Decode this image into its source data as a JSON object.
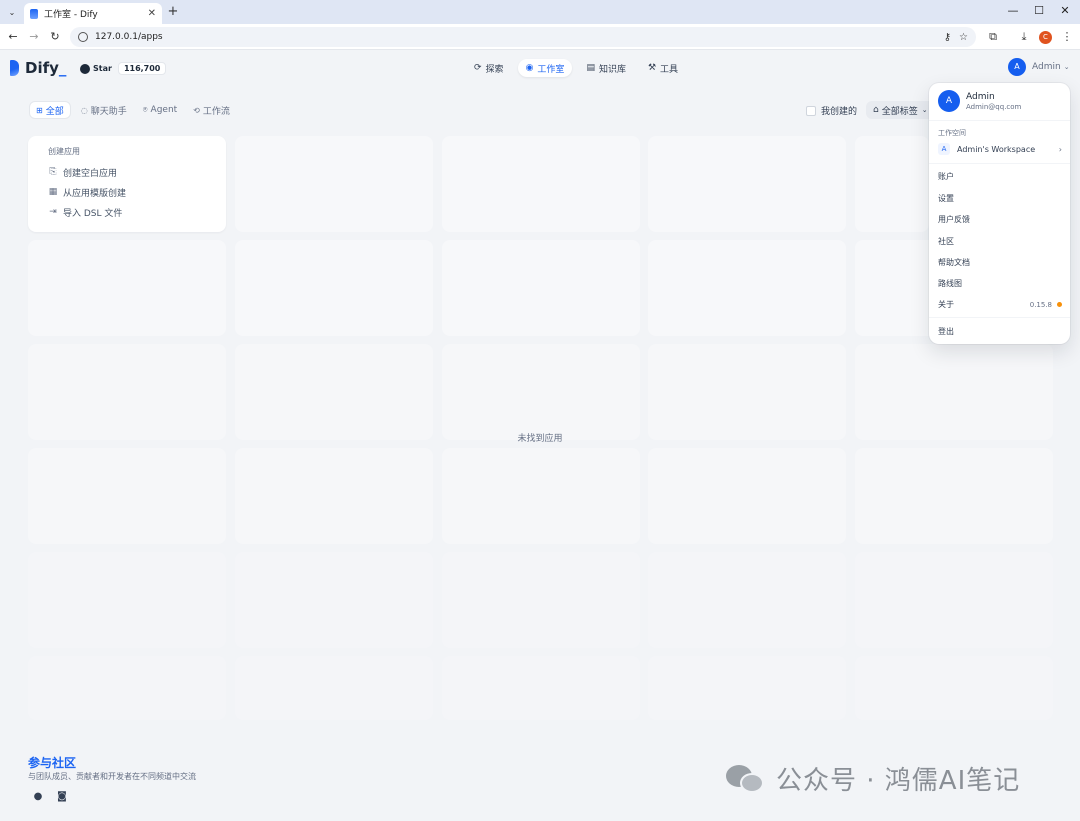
{
  "browser": {
    "tab_title": "工作室 - Dify",
    "url": "127.0.0.1/apps",
    "profile_initial": "C"
  },
  "header": {
    "logo_text": "Dify",
    "github": {
      "label": "Star",
      "count": "116,700"
    },
    "nav": [
      {
        "label": "探索",
        "icon": "explore-icon"
      },
      {
        "label": "工作室",
        "icon": "robot-icon"
      },
      {
        "label": "知识库",
        "icon": "book-icon"
      },
      {
        "label": "工具",
        "icon": "tool-icon"
      }
    ],
    "user": {
      "initial": "A",
      "name": "Admin"
    }
  },
  "filters": {
    "tabs": [
      {
        "label": "全部",
        "icon": "grid-icon"
      },
      {
        "label": "聊天助手",
        "icon": "chat-icon"
      },
      {
        "label": "Agent",
        "icon": "agent-icon"
      },
      {
        "label": "工作流",
        "icon": "workflow-icon"
      }
    ],
    "mine_label": "我创建的",
    "tag_filter": "全部标签"
  },
  "create_card": {
    "title": "创建应用",
    "items": [
      {
        "label": "创建空白应用",
        "icon": "file-plus-icon"
      },
      {
        "label": "从应用模版创建",
        "icon": "template-icon"
      },
      {
        "label": "导入 DSL 文件",
        "icon": "import-icon"
      }
    ]
  },
  "empty_text": "未找到应用",
  "footer": {
    "title": "参与社区",
    "subtitle": "与团队成员、贡献者和开发者在不同频道中交流"
  },
  "watermark": "公众号 · 鸿儒AI笔记",
  "dropdown": {
    "avatar_initial": "A",
    "name": "Admin",
    "email": "Admin@qq.com",
    "workspace_section": "工作空间",
    "workspace_badge": "A",
    "workspace_name": "Admin's Workspace",
    "items": [
      "账户",
      "设置",
      "用户反馈",
      "社区",
      "帮助文档",
      "路线图"
    ],
    "about": {
      "label": "关于",
      "version": "0.15.8"
    },
    "logout": "登出"
  }
}
